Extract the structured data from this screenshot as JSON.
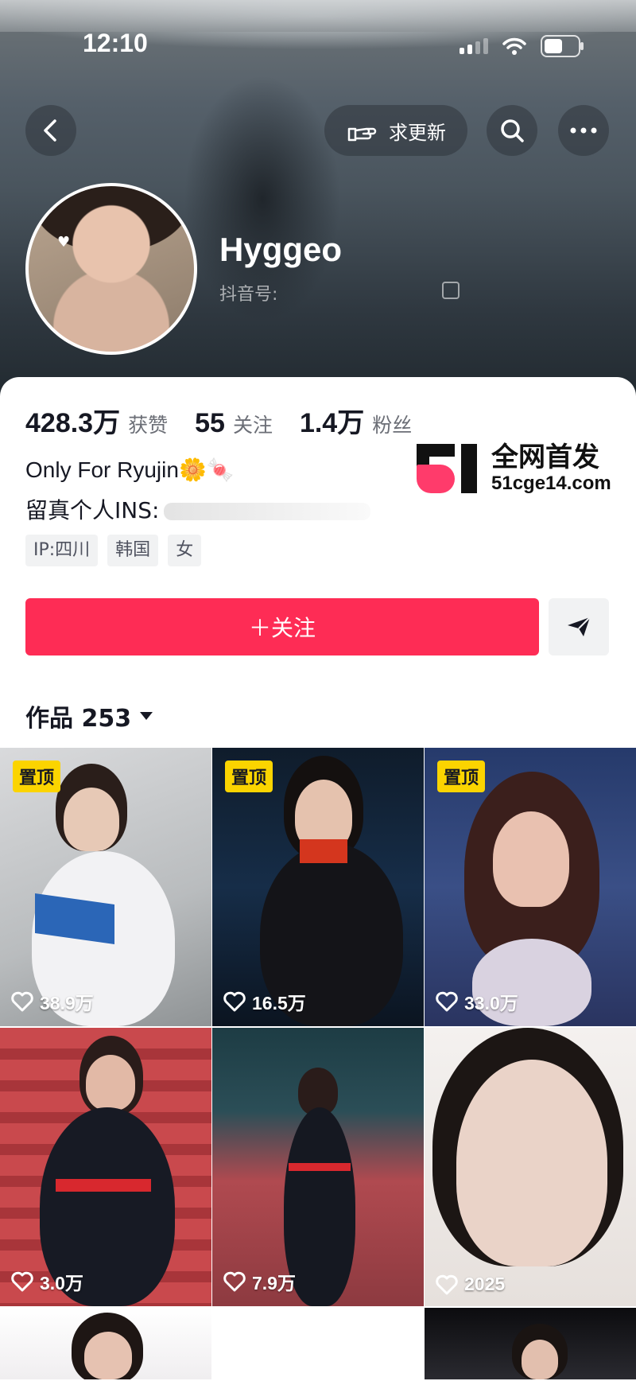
{
  "status_bar": {
    "time": "12:10"
  },
  "header": {
    "request_update_label": "求更新",
    "profile_name": "Hyggeo",
    "douyin_id_label": "抖音号:"
  },
  "stats": [
    {
      "value": "428.3万",
      "label": "获赞"
    },
    {
      "value": "55",
      "label": "关注"
    },
    {
      "value": "1.4万",
      "label": "粉丝"
    }
  ],
  "bio": {
    "line1": "Only For Ryujin🌼🍬",
    "line2": "留真个人INS:"
  },
  "tags": [
    "IP:四川",
    "韩国",
    "女"
  ],
  "follow_button": "＋关注",
  "works": {
    "label": "作品 253"
  },
  "watermark": {
    "line1": "全网首发",
    "line2": "51cge14.com"
  },
  "videos": [
    {
      "pinned": true,
      "pin_label": "置顶",
      "likes": "38.9万"
    },
    {
      "pinned": true,
      "pin_label": "置顶",
      "likes": "16.5万"
    },
    {
      "pinned": true,
      "pin_label": "置顶",
      "likes": "33.0万"
    },
    {
      "pinned": false,
      "likes": "3.0万"
    },
    {
      "pinned": false,
      "likes": "7.9万"
    },
    {
      "pinned": false,
      "likes": "2025"
    }
  ]
}
